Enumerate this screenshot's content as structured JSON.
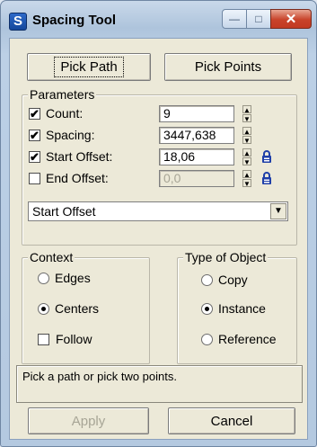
{
  "window": {
    "title": "Spacing Tool",
    "app_icon_letter": "S",
    "minimize_glyph": "—",
    "maximize_glyph": "□",
    "close_glyph": "✕"
  },
  "top_buttons": {
    "pick_path": "Pick Path",
    "pick_points": "Pick Points"
  },
  "parameters": {
    "legend": "Parameters",
    "count": {
      "label": "Count:",
      "checked": true,
      "value": "9"
    },
    "spacing": {
      "label": "Spacing:",
      "checked": true,
      "value": "3447,638"
    },
    "start_offset": {
      "label": "Start Offset:",
      "checked": true,
      "value": "18,06",
      "lock": true
    },
    "end_offset": {
      "label": "End Offset:",
      "checked": false,
      "value": "0,0",
      "lock": true
    },
    "dropdown_value": "Start Offset"
  },
  "context": {
    "legend": "Context",
    "edges": "Edges",
    "centers": "Centers",
    "follow": "Follow",
    "selected": "centers",
    "follow_checked": false
  },
  "type_of_object": {
    "legend": "Type of Object",
    "copy": "Copy",
    "instance": "Instance",
    "reference": "Reference",
    "selected": "instance"
  },
  "status_text": "Pick a path or pick two points.",
  "bottom_buttons": {
    "apply": "Apply",
    "cancel": "Cancel"
  },
  "colors": {
    "dialog_bg": "#ece9d8",
    "lock_icon": "#1f3fa8",
    "close_button": "#c8432a"
  }
}
